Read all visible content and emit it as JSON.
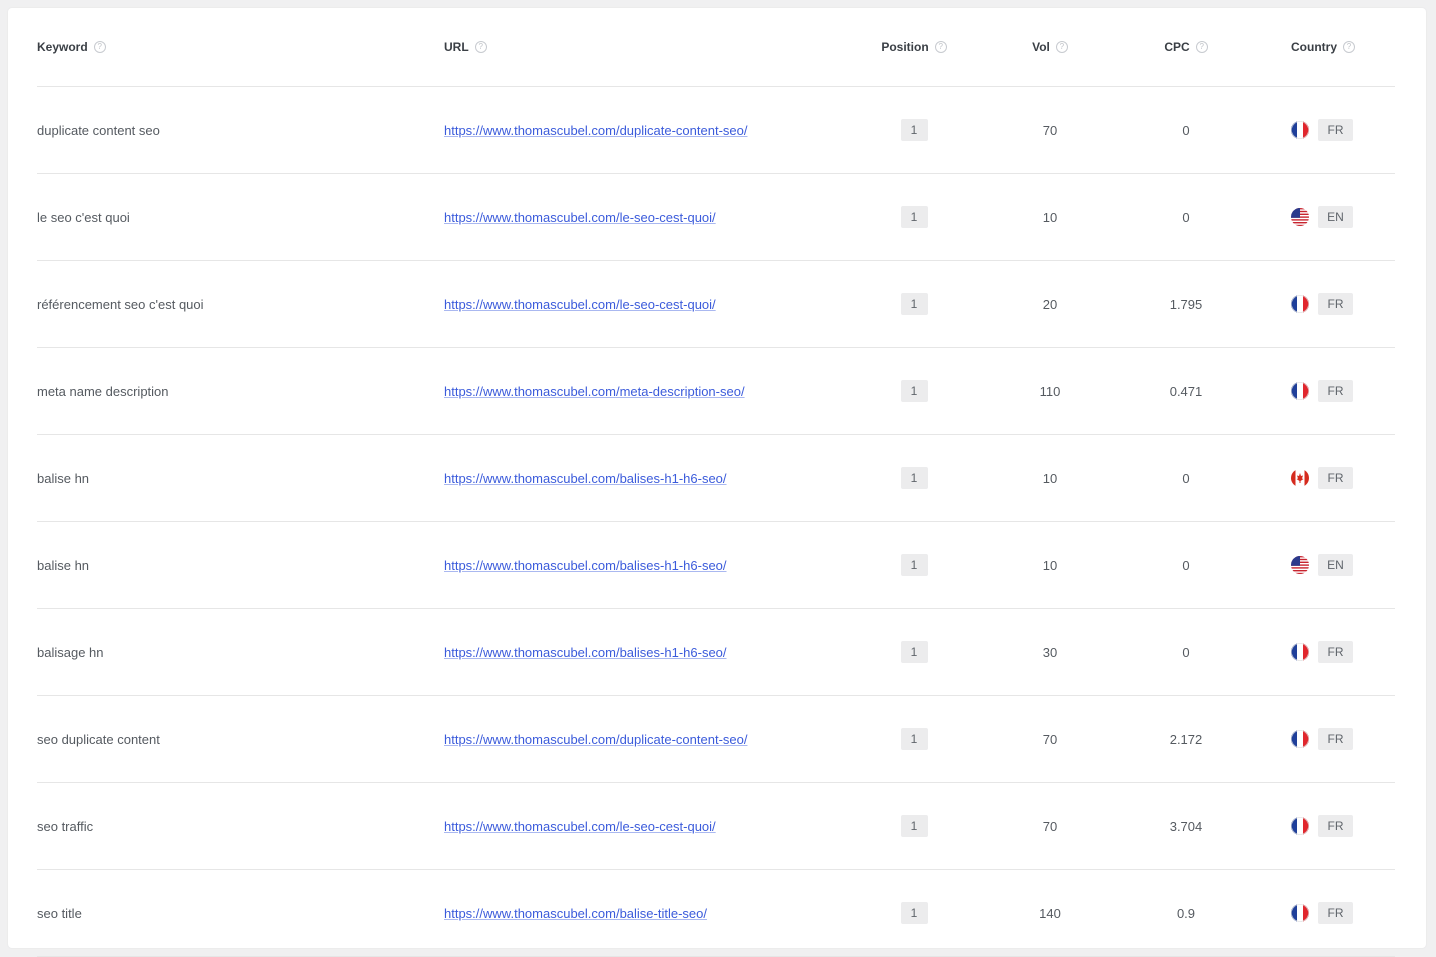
{
  "columns": {
    "keyword": "Keyword",
    "url": "URL",
    "position": "Position",
    "vol": "Vol",
    "cpc": "CPC",
    "country": "Country"
  },
  "rows": [
    {
      "keyword": "duplicate content seo",
      "url": "https://www.thomascubel.com/duplicate-content-seo/",
      "position": "1",
      "vol": "70",
      "cpc": "0",
      "flag": "france-flag-icon",
      "lang": "FR"
    },
    {
      "keyword": "le seo c'est quoi",
      "url": "https://www.thomascubel.com/le-seo-cest-quoi/",
      "position": "1",
      "vol": "10",
      "cpc": "0",
      "flag": "usa-flag-icon",
      "lang": "EN"
    },
    {
      "keyword": "référencement seo c'est quoi",
      "url": "https://www.thomascubel.com/le-seo-cest-quoi/",
      "position": "1",
      "vol": "20",
      "cpc": "1.795",
      "flag": "france-flag-icon",
      "lang": "FR"
    },
    {
      "keyword": "meta name description",
      "url": "https://www.thomascubel.com/meta-description-seo/",
      "position": "1",
      "vol": "110",
      "cpc": "0.471",
      "flag": "france-flag-icon",
      "lang": "FR"
    },
    {
      "keyword": "balise hn",
      "url": "https://www.thomascubel.com/balises-h1-h6-seo/",
      "position": "1",
      "vol": "10",
      "cpc": "0",
      "flag": "canada-flag-icon",
      "lang": "FR"
    },
    {
      "keyword": "balise hn",
      "url": "https://www.thomascubel.com/balises-h1-h6-seo/",
      "position": "1",
      "vol": "10",
      "cpc": "0",
      "flag": "usa-flag-icon",
      "lang": "EN"
    },
    {
      "keyword": "balisage hn",
      "url": "https://www.thomascubel.com/balises-h1-h6-seo/",
      "position": "1",
      "vol": "30",
      "cpc": "0",
      "flag": "france-flag-icon",
      "lang": "FR"
    },
    {
      "keyword": "seo duplicate content",
      "url": "https://www.thomascubel.com/duplicate-content-seo/",
      "position": "1",
      "vol": "70",
      "cpc": "2.172",
      "flag": "france-flag-icon",
      "lang": "FR"
    },
    {
      "keyword": "seo traffic",
      "url": "https://www.thomascubel.com/le-seo-cest-quoi/",
      "position": "1",
      "vol": "70",
      "cpc": "3.704",
      "flag": "france-flag-icon",
      "lang": "FR"
    },
    {
      "keyword": "seo title",
      "url": "https://www.thomascubel.com/balise-title-seo/",
      "position": "1",
      "vol": "140",
      "cpc": "0.9",
      "flag": "france-flag-icon",
      "lang": "FR"
    }
  ],
  "colors": {
    "link": "#3b5bdb",
    "badge_bg": "#ececed",
    "divider": "#e6e6e6"
  }
}
